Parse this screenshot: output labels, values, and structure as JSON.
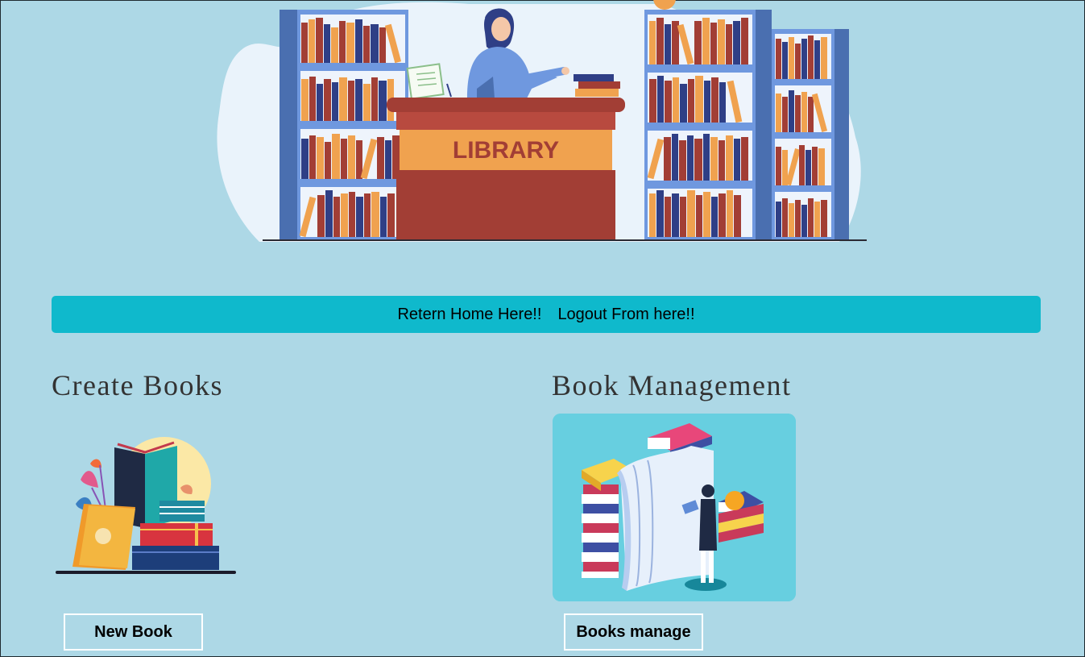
{
  "hero": {
    "sign_text": "LIBRARY"
  },
  "nav": {
    "home_link": "Retern Home Here!!",
    "logout_link": "Logout From here!!"
  },
  "sections": {
    "create": {
      "title": "Create Books",
      "button_label": "New Book"
    },
    "manage": {
      "title": "Book Management",
      "button_label": "Books manage"
    }
  },
  "colors": {
    "page_background": "#add8e6",
    "nav_background": "#0fb9cc",
    "desk_red": "#a23e35",
    "desk_sign": "#f0a24f",
    "shelf_blue": "#4a6fb0"
  }
}
